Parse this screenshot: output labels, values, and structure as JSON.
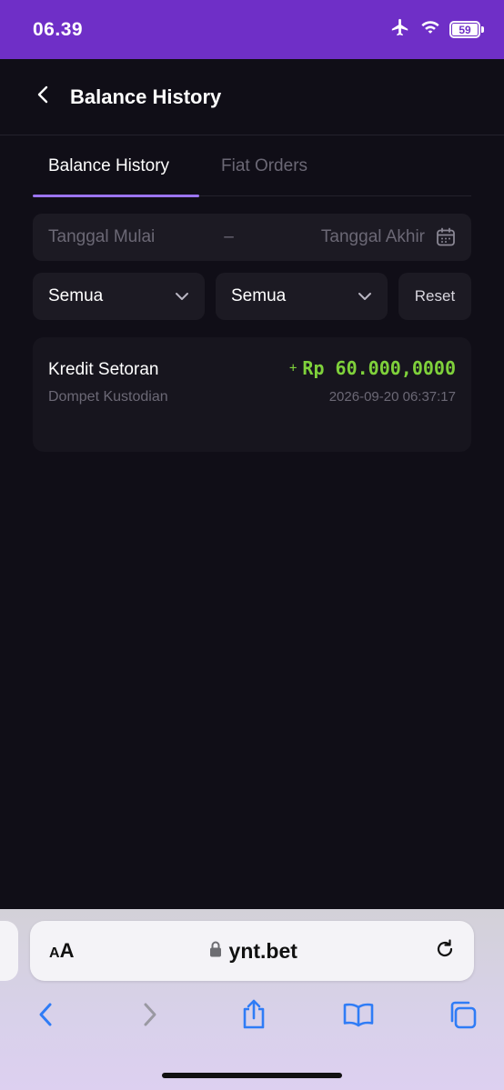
{
  "status_bar": {
    "time": "06.39",
    "battery": "59"
  },
  "header": {
    "title": "Balance History"
  },
  "tabs": [
    {
      "label": "Balance History",
      "active": true
    },
    {
      "label": "Fiat Orders",
      "active": false
    }
  ],
  "date_filter": {
    "start_placeholder": "Tanggal Mulai",
    "separator": "–",
    "end_placeholder": "Tanggal Akhir"
  },
  "filters": {
    "select_1": "Semua",
    "select_2": "Semua",
    "reset_label": "Reset"
  },
  "records": [
    {
      "title": "Kredit Setoran",
      "sign": "+",
      "amount": "Rp 60.000,0000",
      "subtitle": "Dompet Kustodian",
      "timestamp": "2026-09-20 06:37:17"
    }
  ],
  "browser": {
    "aa_small": "A",
    "aa_large": "A",
    "url": "ynt.bet"
  },
  "colors": {
    "accent": "#9b74f0",
    "status_bar": "#6f2fc7",
    "positive": "#7fd13b",
    "background": "#100e17",
    "browser_blue": "#2f7cf6"
  },
  "icons": {
    "status": [
      "airplane-icon",
      "wifi-icon",
      "battery-icon"
    ],
    "header": [
      "back-chevron-icon"
    ],
    "date": [
      "calendar-icon"
    ],
    "browser": [
      "lock-icon",
      "reload-icon",
      "back-arrow-icon",
      "forward-arrow-icon",
      "share-icon",
      "bookmarks-icon",
      "tabs-icon"
    ]
  }
}
